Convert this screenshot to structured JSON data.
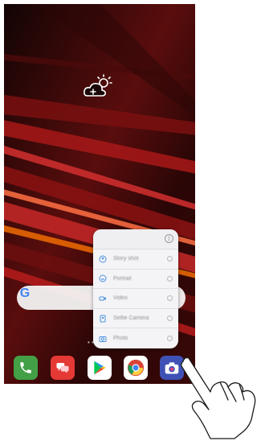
{
  "home": {
    "weather_icon": "cloud-sun-plus-icon",
    "search_widget": {
      "logo_text": "G",
      "icon": "google-logo-icon"
    },
    "page_indicator": "• •"
  },
  "shortcut_popup": {
    "info_icon_text": "i",
    "items": [
      {
        "label": "Story shot",
        "icon": "story-shot-icon"
      },
      {
        "label": "Portrait",
        "icon": "portrait-icon"
      },
      {
        "label": "Video",
        "icon": "video-icon"
      },
      {
        "label": "Selfie Camera",
        "icon": "selfie-camera-icon"
      },
      {
        "label": "Photo",
        "icon": "photo-icon"
      }
    ]
  },
  "dock": [
    {
      "app": "Phone",
      "icon": "phone-icon",
      "color": "#4caf50"
    },
    {
      "app": "Messages",
      "icon": "messages-icon",
      "color": "#e53935"
    },
    {
      "app": "Play Store",
      "icon": "play-store-icon",
      "color": "#ffffff"
    },
    {
      "app": "Chrome",
      "icon": "chrome-icon",
      "color": "#ffffff"
    },
    {
      "app": "Camera",
      "icon": "camera-icon",
      "color": "#3f51b5"
    }
  ],
  "colors": {
    "wallpaper_dark": "#1a0808",
    "wallpaper_red": "#c62828",
    "wallpaper_orange": "#e65100",
    "popup_bg": "#f4f4f6",
    "icon_accent": "#4a90e2"
  }
}
